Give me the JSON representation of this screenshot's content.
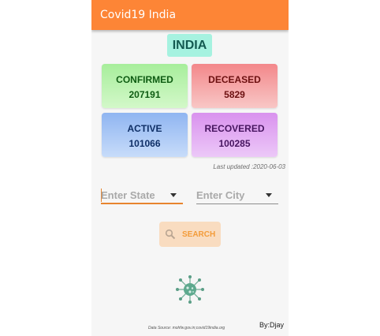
{
  "app": {
    "title": "Covid19 India"
  },
  "region": {
    "name": "INDIA"
  },
  "stats": {
    "confirmed": {
      "label": "CONFIRMED",
      "value": "207191"
    },
    "deceased": {
      "label": "DECEASED",
      "value": "5829"
    },
    "active": {
      "label": "ACTIVE",
      "value": "101066"
    },
    "recovered": {
      "label": "RECOVERED",
      "value": "100285"
    }
  },
  "last_updated": "Last updated :2020-06-03",
  "filters": {
    "state_placeholder": "Enter State",
    "city_placeholder": "Enter City"
  },
  "search": {
    "label": "SEARCH",
    "icon": "search-icon"
  },
  "footer": {
    "source": "Data Source: mohfw.gov.in;covid19india.org",
    "author": "By:Djay"
  },
  "colors": {
    "appbar": "#fd8536",
    "confirmed": "#a7ee9b",
    "deceased": "#f3878a",
    "active": "#8fb5f1",
    "recovered": "#d992ee",
    "accent": "#e7842e"
  }
}
